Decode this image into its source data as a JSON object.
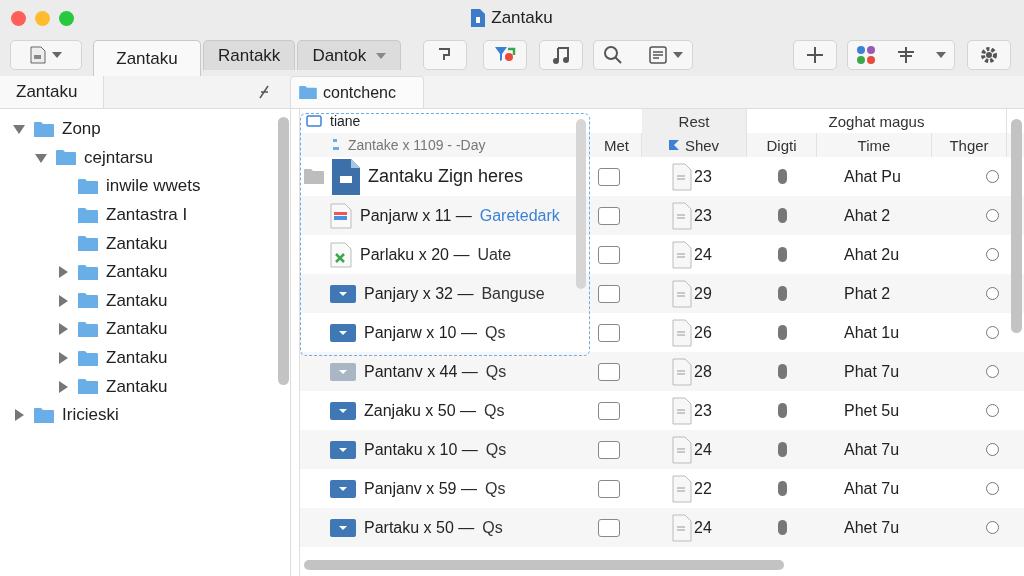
{
  "window": {
    "title": "Zantaku"
  },
  "toolbar": {
    "tabs": [
      {
        "label": "Zantaku",
        "selected": true,
        "menu": false
      },
      {
        "label": "Rantakk",
        "selected": false,
        "menu": false
      },
      {
        "label": "Dantok",
        "selected": false,
        "menu": true
      }
    ]
  },
  "sidebar": {
    "tab": "Zantaku",
    "items": [
      {
        "label": "Zonp",
        "expandable": true,
        "expanded": true,
        "children": [
          {
            "label": "cejntarsu",
            "expandable": true,
            "expanded": true,
            "children": [
              {
                "label": "inwile wwets",
                "expandable": false,
                "expanded": false
              },
              {
                "label": "Zantastra I",
                "expandable": false,
                "expanded": false
              },
              {
                "label": "Zantaku",
                "expandable": false,
                "expanded": false
              },
              {
                "label": "Zantaku",
                "expandable": true,
                "expanded": false
              },
              {
                "label": "Zantaku",
                "expandable": true,
                "expanded": false
              },
              {
                "label": "Zantaku",
                "expandable": true,
                "expanded": false
              },
              {
                "label": "Zantaku",
                "expandable": true,
                "expanded": false
              },
              {
                "label": "Zantaku",
                "expandable": true,
                "expanded": false
              }
            ]
          }
        ]
      },
      {
        "label": "Iricieski",
        "expandable": true,
        "expanded": false
      }
    ]
  },
  "path_tab": "contchenc",
  "table": {
    "title": "tiane",
    "subtitle": "Zantake x 1109 - -Day",
    "groups": [
      "Rest",
      "Zoghat magus"
    ],
    "columns": [
      {
        "label": "Met",
        "sorted": false
      },
      {
        "label": "Shev",
        "sorted": true
      },
      {
        "label": "Digti",
        "sorted": false
      },
      {
        "label": "Time",
        "sorted": false
      },
      {
        "label": "Thger",
        "sorted": false
      }
    ],
    "rows": [
      {
        "kind": "document",
        "tagged": true,
        "name": "Zantaku Zign heres",
        "checked": false,
        "shev": "23",
        "time": "Ahat Pu",
        "selected": false
      },
      {
        "kind": "chart",
        "tagged": false,
        "name": "Panjarw x 11 —",
        "detail": "Garetedark",
        "link": true,
        "checked": false,
        "shev": "23",
        "time": "Ahat 2",
        "selected": false
      },
      {
        "kind": "sheet",
        "tagged": false,
        "name": "Parlaku x 20 —",
        "detail": "Uate",
        "link": false,
        "checked": false,
        "shev": "24",
        "time": "Ahat 2u",
        "selected": false
      },
      {
        "kind": "folder",
        "tagged": false,
        "name": "Panjary x 32 —",
        "detail": "Banguse",
        "link": false,
        "checked": false,
        "shev": "29",
        "time": "Phat 2",
        "selected": false
      },
      {
        "kind": "folder",
        "tagged": false,
        "name": "Panjarw x 10 —",
        "detail": "Qs",
        "link": false,
        "checked": false,
        "shev": "26",
        "time": "Ahat 1u",
        "selected": false
      },
      {
        "kind": "dimmed",
        "tagged": false,
        "name": "Pantanv x 44 —",
        "detail": "Qs",
        "link": false,
        "checked": false,
        "shev": "28",
        "time": "Phat 7u",
        "selected": false
      },
      {
        "kind": "folder",
        "tagged": false,
        "name": "Zanjaku x 50 —",
        "detail": "Qs",
        "link": false,
        "checked": false,
        "shev": "23",
        "time": "Phet 5u",
        "selected": false
      },
      {
        "kind": "folder",
        "tagged": false,
        "name": "Pantaku x 10 —",
        "detail": "Qs",
        "link": false,
        "checked": false,
        "shev": "24",
        "time": "Ahat 7u",
        "selected": false
      },
      {
        "kind": "folder",
        "tagged": false,
        "name": "Panjanv x 59 —",
        "detail": "Qs",
        "link": false,
        "checked": false,
        "shev": "22",
        "time": "Ahat 7u",
        "selected": false
      },
      {
        "kind": "folder",
        "tagged": false,
        "name": "Partaku x 50 —",
        "detail": "Qs",
        "link": false,
        "checked": false,
        "shev": "24",
        "time": "Ahet 7u",
        "selected": false
      }
    ]
  }
}
